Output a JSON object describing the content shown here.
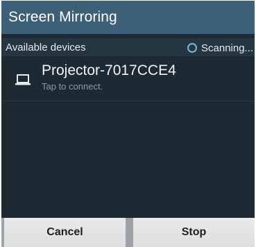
{
  "dialog": {
    "title": "Screen Mirroring"
  },
  "devices_section": {
    "label": "Available devices",
    "status": "Scanning..."
  },
  "devices": [
    {
      "icon": "laptop-icon",
      "name": "Projector-7017CCE4",
      "subtitle": "Tap to connect."
    }
  ],
  "buttons": {
    "cancel_label": "Cancel",
    "stop_label": "Stop"
  },
  "colors": {
    "title_bar": "#3e5f78",
    "body_background": "#1d2a34",
    "section_header": "#263641",
    "spinner_accent": "#7fb6e0"
  }
}
